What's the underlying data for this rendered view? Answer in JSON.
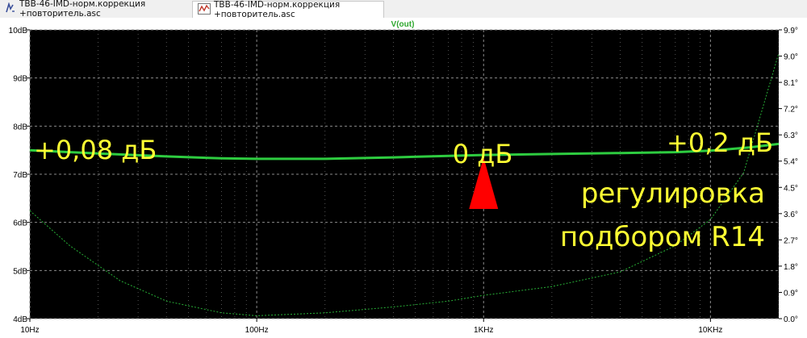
{
  "tabs": [
    {
      "label": "ТВВ-46-IMD-норм.коррекция +повторитель.asc",
      "icon": "schematic-icon",
      "active": false
    },
    {
      "label": "ТВВ-46-IMD-норм.коррекция +повторитель.asc",
      "icon": "waveform-icon",
      "active": true
    }
  ],
  "colors": {
    "background": "#000000",
    "grid": "#8a8a8a",
    "trace": "#2ecc40",
    "phase_trace": "#2ecc40",
    "annotation_text": "#ffff33",
    "marker": "#ff0000",
    "axis_text": "#000000",
    "trace_label": "#2fa82f"
  },
  "chart_data": {
    "type": "line",
    "title": "V(out)",
    "x_scale": "log",
    "xlim": [
      10,
      20000
    ],
    "x_ticks": [
      {
        "value": 10,
        "label": "10Hz"
      },
      {
        "value": 100,
        "label": "100Hz"
      },
      {
        "value": 1000,
        "label": "1KHz"
      },
      {
        "value": 10000,
        "label": "10KHz"
      }
    ],
    "ylim": [
      4,
      10
    ],
    "y_unit": "dB",
    "y_ticks": [
      {
        "value": 10,
        "label": "10dB"
      },
      {
        "value": 9,
        "label": "9dB"
      },
      {
        "value": 8,
        "label": "8dB"
      },
      {
        "value": 7,
        "label": "7dB"
      },
      {
        "value": 6,
        "label": "6dB"
      },
      {
        "value": 5,
        "label": "5dB"
      },
      {
        "value": 4,
        "label": "4dB"
      }
    ],
    "y2lim": [
      0,
      9.9
    ],
    "y2_ticks": [
      {
        "value": 9.9,
        "label": "9.9°"
      },
      {
        "value": 9.0,
        "label": "9.0°"
      },
      {
        "value": 8.1,
        "label": "8.1°"
      },
      {
        "value": 7.2,
        "label": "7.2°"
      },
      {
        "value": 6.3,
        "label": "6.3°"
      },
      {
        "value": 5.4,
        "label": "5.4°"
      },
      {
        "value": 4.5,
        "label": "4.5°"
      },
      {
        "value": 3.6,
        "label": "3.6°"
      },
      {
        "value": 2.7,
        "label": "2.7°"
      },
      {
        "value": 1.8,
        "label": "1.8°"
      },
      {
        "value": 0.9,
        "label": "0.9°"
      },
      {
        "value": 0.0,
        "label": "0.0°"
      }
    ],
    "grid": true,
    "series": [
      {
        "name": "V(out)",
        "axis": "left",
        "style": "solid",
        "points": [
          [
            10,
            7.5
          ],
          [
            20,
            7.43
          ],
          [
            40,
            7.37
          ],
          [
            70,
            7.33
          ],
          [
            100,
            7.32
          ],
          [
            200,
            7.32
          ],
          [
            400,
            7.35
          ],
          [
            700,
            7.38
          ],
          [
            1000,
            7.4
          ],
          [
            2000,
            7.42
          ],
          [
            4000,
            7.44
          ],
          [
            7000,
            7.46
          ],
          [
            10000,
            7.49
          ],
          [
            15000,
            7.56
          ],
          [
            20000,
            7.63
          ]
        ]
      },
      {
        "axis": "right",
        "style": "dashed",
        "points": [
          [
            10,
            3.7
          ],
          [
            15,
            2.5
          ],
          [
            25,
            1.3
          ],
          [
            40,
            0.6
          ],
          [
            70,
            0.2
          ],
          [
            100,
            0.1
          ],
          [
            200,
            0.2
          ],
          [
            400,
            0.4
          ],
          [
            700,
            0.6
          ],
          [
            1000,
            0.8
          ],
          [
            2000,
            1.1
          ],
          [
            4000,
            1.6
          ],
          [
            7000,
            2.5
          ],
          [
            10000,
            3.4
          ],
          [
            14000,
            5.0
          ],
          [
            20000,
            9.1
          ]
        ]
      }
    ],
    "annotations": [
      {
        "text": "+0,08 дБ",
        "at": [
          10,
          7.5
        ]
      },
      {
        "text": "0 дБ",
        "at": [
          1000,
          7.4
        ]
      },
      {
        "text": "+0,2 дБ",
        "at": [
          20000,
          7.63
        ]
      },
      {
        "text": "регулировка",
        "at": [
          20000,
          7.0
        ]
      },
      {
        "text": "подбором R14",
        "at": [
          20000,
          6.2
        ]
      }
    ],
    "marker": {
      "shape": "triangle-up",
      "x": 1000,
      "y_top": 7.35,
      "y_bottom": 6.28
    }
  }
}
